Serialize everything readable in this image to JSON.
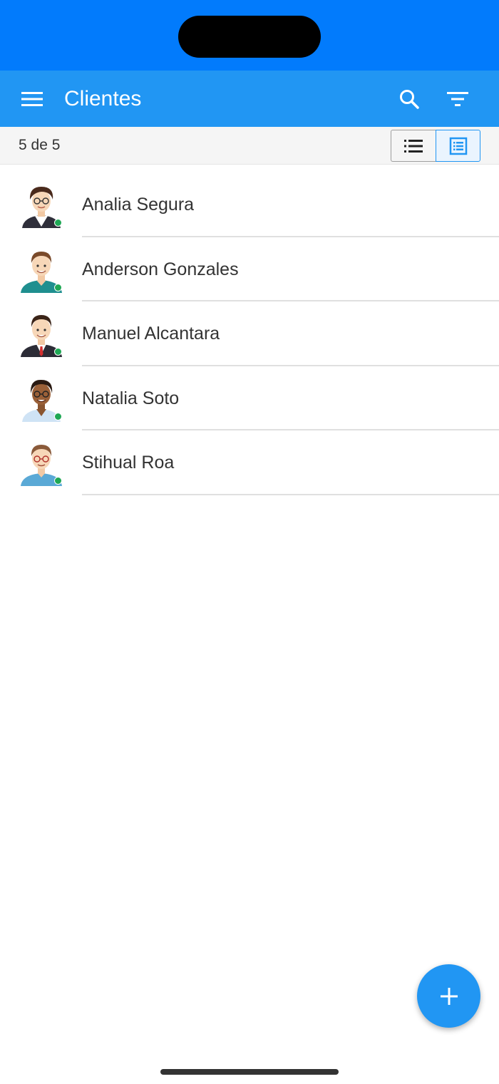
{
  "app_bar": {
    "title": "Clientes"
  },
  "sub_bar": {
    "count": "5 de 5"
  },
  "view_toggle": {
    "selected": "detail"
  },
  "clients": [
    {
      "name": "Analia Segura",
      "online": true,
      "avatar": "woman-short-hair-glasses"
    },
    {
      "name": "Anderson Gonzales",
      "online": true,
      "avatar": "man-teal-sweater"
    },
    {
      "name": "Manuel Alcantara",
      "online": true,
      "avatar": "man-suit-red-tie"
    },
    {
      "name": "Natalia Soto",
      "online": true,
      "avatar": "woman-glasses-blue-blouse"
    },
    {
      "name": "Stihual Roa",
      "online": true,
      "avatar": "man-glasses-blue-shirt"
    }
  ],
  "colors": {
    "status_bar": "#027bfc",
    "app_bar": "#2196f3",
    "online": "#1fa855",
    "fab": "#2196f3"
  }
}
